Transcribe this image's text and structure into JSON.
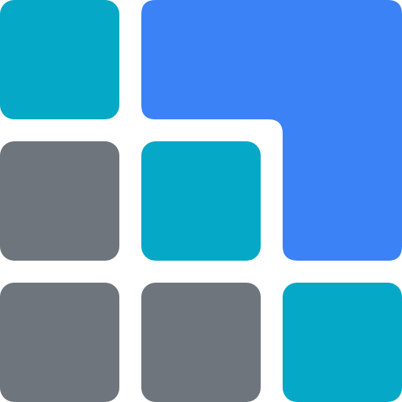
{
  "colors": {
    "background": "#ffffff",
    "teal": "#06A8C7",
    "gray": "#6F757D",
    "blue": "#3B82F6"
  },
  "icons": {
    "mosaic": "tile-mosaic-icon"
  }
}
